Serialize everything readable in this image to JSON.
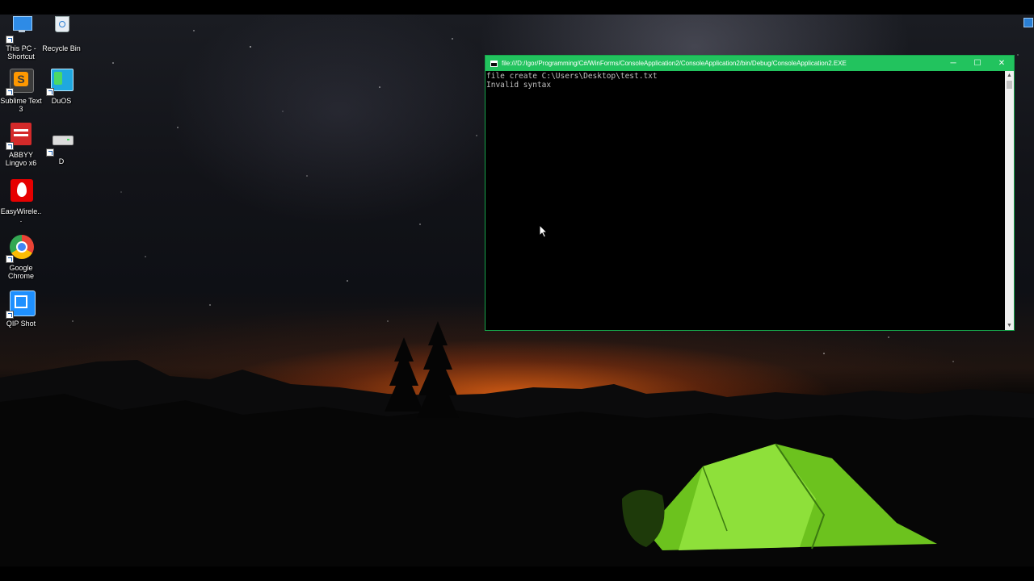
{
  "desktop": {
    "icons": [
      {
        "label": "This PC - Shortcut",
        "icon": "this-pc-icon"
      },
      {
        "label": "Recycle Bin",
        "icon": "recycle-bin-icon"
      },
      {
        "label": "Sublime Text 3",
        "icon": "sublime-text-icon"
      },
      {
        "label": "DuOS",
        "icon": "duos-icon"
      },
      {
        "label": "ABBYY Lingvo x6",
        "icon": "abbyy-lingvo-icon"
      },
      {
        "label": "D",
        "icon": "drive-icon"
      },
      {
        "label": "EasyWirele...",
        "icon": "easywireless-icon"
      },
      {
        "label": "Google Chrome",
        "icon": "chrome-icon"
      },
      {
        "label": "QIP Shot",
        "icon": "qip-shot-icon"
      }
    ]
  },
  "console": {
    "title": "file:///D:/Igor/Programming/C#/WinForms/ConsoleApplication2/ConsoleApplication2/bin/Debug/ConsoleApplication2.EXE",
    "lines": [
      "file create C:\\Users\\Desktop\\test.txt",
      "Invalid syntax"
    ],
    "controls": {
      "minimize": "─",
      "maximize": "☐",
      "close": "✕"
    },
    "accent_color": "#22c35e"
  }
}
